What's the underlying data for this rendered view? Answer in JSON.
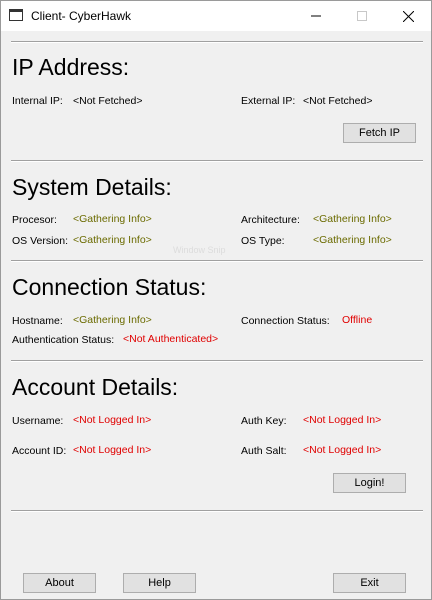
{
  "window": {
    "title": "Client- CyberHawk"
  },
  "ip_section": {
    "heading": "IP Address:",
    "internal_ip_label": "Internal IP:",
    "internal_ip_value": "<Not Fetched>",
    "external_ip_label": "External IP:",
    "external_ip_value": "<Not Fetched>",
    "fetch_button": "Fetch IP"
  },
  "system_section": {
    "heading": "System Details:",
    "processor_label": "Procesor:",
    "processor_value": "<Gathering Info>",
    "architecture_label": "Architecture:",
    "architecture_value": "<Gathering Info>",
    "os_version_label": "OS Version:",
    "os_version_value": "<Gathering Info>",
    "os_type_label": "OS Type:",
    "os_type_value": "<Gathering Info>"
  },
  "connection_section": {
    "heading": "Connection Status:",
    "hostname_label": "Hostname:",
    "hostname_value": "<Gathering Info>",
    "connection_status_label": "Connection Status:",
    "connection_status_value": "Offline",
    "auth_status_label": "Authentication Status:",
    "auth_status_value": "<Not Authenticated>"
  },
  "account_section": {
    "heading": "Account Details:",
    "username_label": "Username:",
    "username_value": "<Not Logged In>",
    "auth_key_label": "Auth Key:",
    "auth_key_value": "<Not Logged In>",
    "account_id_label": "Account ID:",
    "account_id_value": "<Not Logged In>",
    "auth_salt_label": "Auth Salt:",
    "auth_salt_value": "<Not Logged In>",
    "login_button": "Login!"
  },
  "footer": {
    "about_button": "About",
    "help_button": "Help",
    "exit_button": "Exit"
  },
  "watermark_text": "Window Snip",
  "colors": {
    "pending": "#6b6b00",
    "alert": "#e00000"
  }
}
